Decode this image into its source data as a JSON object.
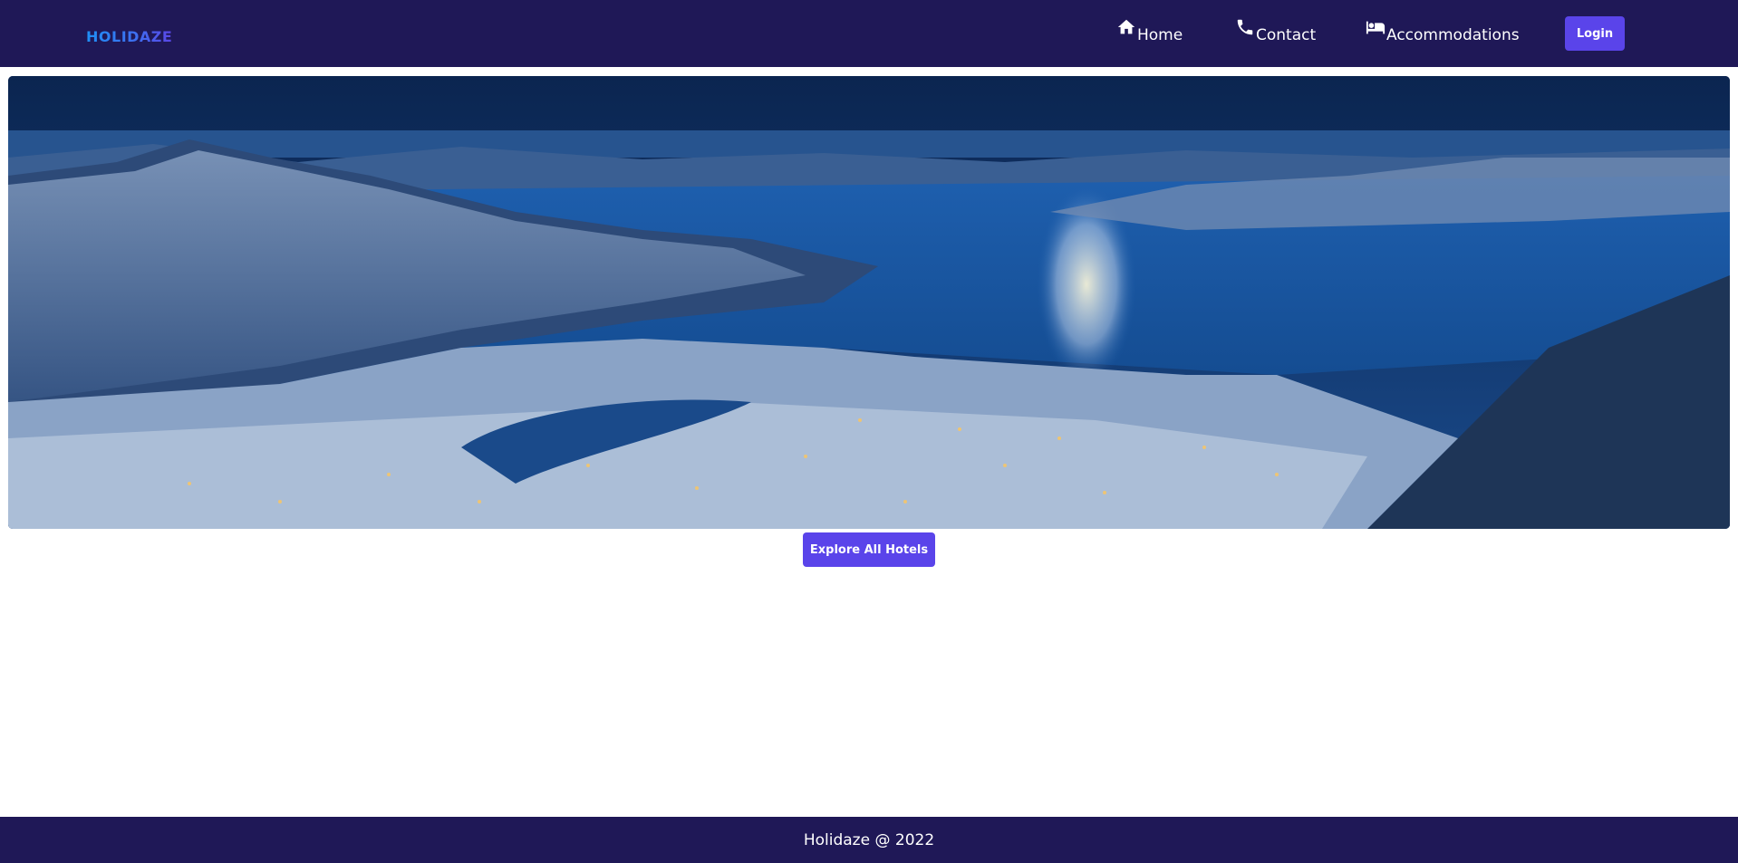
{
  "header": {
    "logo": "HOLIDAZE",
    "nav": [
      {
        "label": "Home",
        "icon": "home-icon"
      },
      {
        "label": "Contact",
        "icon": "phone-icon"
      },
      {
        "label": "Accommodations",
        "icon": "bed-icon"
      }
    ],
    "login_label": "Login"
  },
  "hero": {
    "image": "aerial-night-city-fjord"
  },
  "main": {
    "explore_label": "Explore All Hotels"
  },
  "footer": {
    "text": "Holidaze @ 2022"
  },
  "colors": {
    "navbar_bg": "#1f1857",
    "button_bg": "#5a44ea",
    "logo_gradient_start": "#1f8ff5",
    "logo_gradient_end": "#5a46e6"
  }
}
